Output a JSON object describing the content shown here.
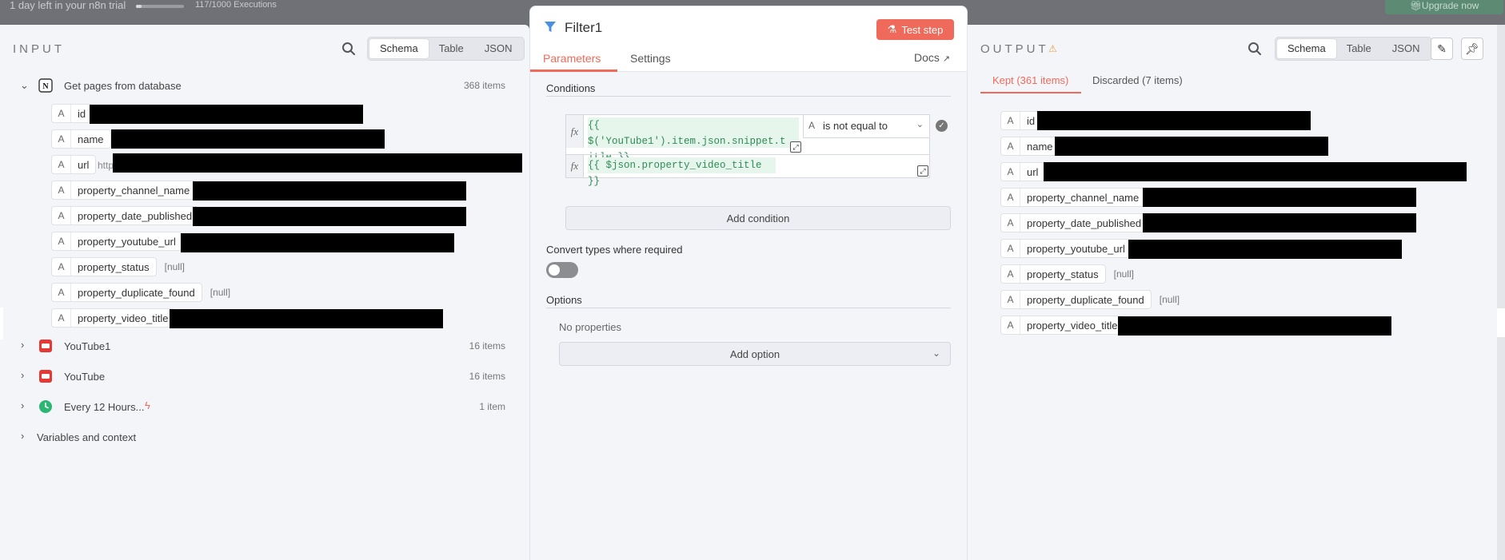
{
  "topbar": {
    "trial_text": "1 day left in your n8n trial",
    "executions": "117/1000 Executions",
    "executions_progress": 0.117,
    "upgrade_label": "Upgrade now"
  },
  "input": {
    "title": "INPUT",
    "view_tabs": [
      "Schema",
      "Table",
      "JSON"
    ],
    "active_view": "Schema",
    "nodes": [
      {
        "label": "Get pages from database",
        "count": "368 items",
        "expanded": true
      },
      {
        "label": "YouTube1",
        "count": "16 items"
      },
      {
        "label": "YouTube",
        "count": "16 items"
      },
      {
        "label": "Every 12 Hours...",
        "count": "1 item"
      },
      {
        "label": "Variables and context"
      }
    ],
    "fields": [
      {
        "name": "id"
      },
      {
        "name": "name"
      },
      {
        "name": "url",
        "prefix": "http"
      },
      {
        "name": "property_channel_name"
      },
      {
        "name": "property_date_published"
      },
      {
        "name": "property_youtube_url"
      },
      {
        "name": "property_status",
        "value": "[null]"
      },
      {
        "name": "property_duplicate_found",
        "value": "[null]"
      },
      {
        "name": "property_video_title"
      }
    ]
  },
  "node_panel": {
    "title": "Filter1",
    "test_label": "Test step",
    "tabs": [
      "Parameters",
      "Settings"
    ],
    "docs_label": "Docs",
    "conditions_label": "Conditions",
    "condition": {
      "left_line1": "{{ $('YouTube1').item.json.snippet.t",
      "left_line2": "itle }}",
      "operator": "is not equal to",
      "right": "{{ $json.property_video_title }}"
    },
    "fx_label": "fx",
    "add_condition_label": "Add condition",
    "convert_label": "Convert types where required",
    "convert_enabled": false,
    "options_label": "Options",
    "no_properties_label": "No properties",
    "add_option_label": "Add option"
  },
  "output": {
    "title": "OUTPUT",
    "view_tabs": [
      "Schema",
      "Table",
      "JSON"
    ],
    "active_view": "Schema",
    "result_tabs": [
      "Kept (361 items)",
      "Discarded (7 items)"
    ],
    "active_result": "Kept (361 items)",
    "fields": [
      {
        "name": "id"
      },
      {
        "name": "name"
      },
      {
        "name": "url"
      },
      {
        "name": "property_channel_name"
      },
      {
        "name": "property_date_published"
      },
      {
        "name": "property_youtube_url"
      },
      {
        "name": "property_status",
        "value": "[null]"
      },
      {
        "name": "property_duplicate_found",
        "value": "[null]"
      },
      {
        "name": "property_video_title"
      }
    ]
  },
  "colors": {
    "accent": "#ef6a5a",
    "upgrade": "#5c8a73",
    "expression_text": "#2e8b57",
    "warning": "#e8a33c"
  }
}
